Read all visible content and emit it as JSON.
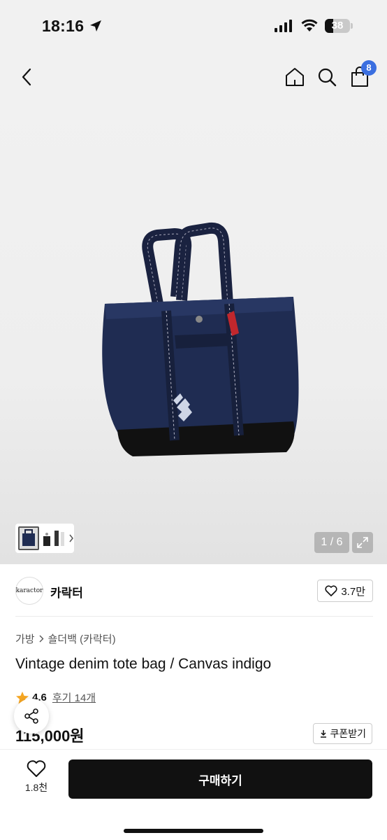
{
  "status_bar": {
    "time": "18:16",
    "battery": "38"
  },
  "nav": {
    "cart_count": "8"
  },
  "gallery": {
    "page_indicator": "1 / 6"
  },
  "brand": {
    "logo_text": "karactor",
    "name": "카락터",
    "likes": "3.7만"
  },
  "breadcrumb": {
    "category": "가방",
    "subcategory": "숄더백 (카락터)"
  },
  "product": {
    "title": "Vintage denim tote bag / Canvas indigo",
    "rating": "4.6",
    "reviews": "후기 14개",
    "price": "115,000원"
  },
  "coupon": {
    "label": "쿠폰받기"
  },
  "bottom": {
    "wish_count": "1.8천",
    "buy_label": "구매하기"
  },
  "colors": {
    "accent": "#3b6fe0",
    "star": "#f5a623",
    "buy_button": "#111111",
    "denim": "#1f2c52"
  },
  "icons": [
    "location-arrow-icon",
    "signal-icon",
    "wifi-icon",
    "battery-icon",
    "back-chevron-icon",
    "home-icon",
    "search-icon",
    "cart-icon",
    "chevron-right-icon",
    "expand-icon",
    "heart-icon",
    "star-icon",
    "download-icon",
    "share-icon"
  ]
}
